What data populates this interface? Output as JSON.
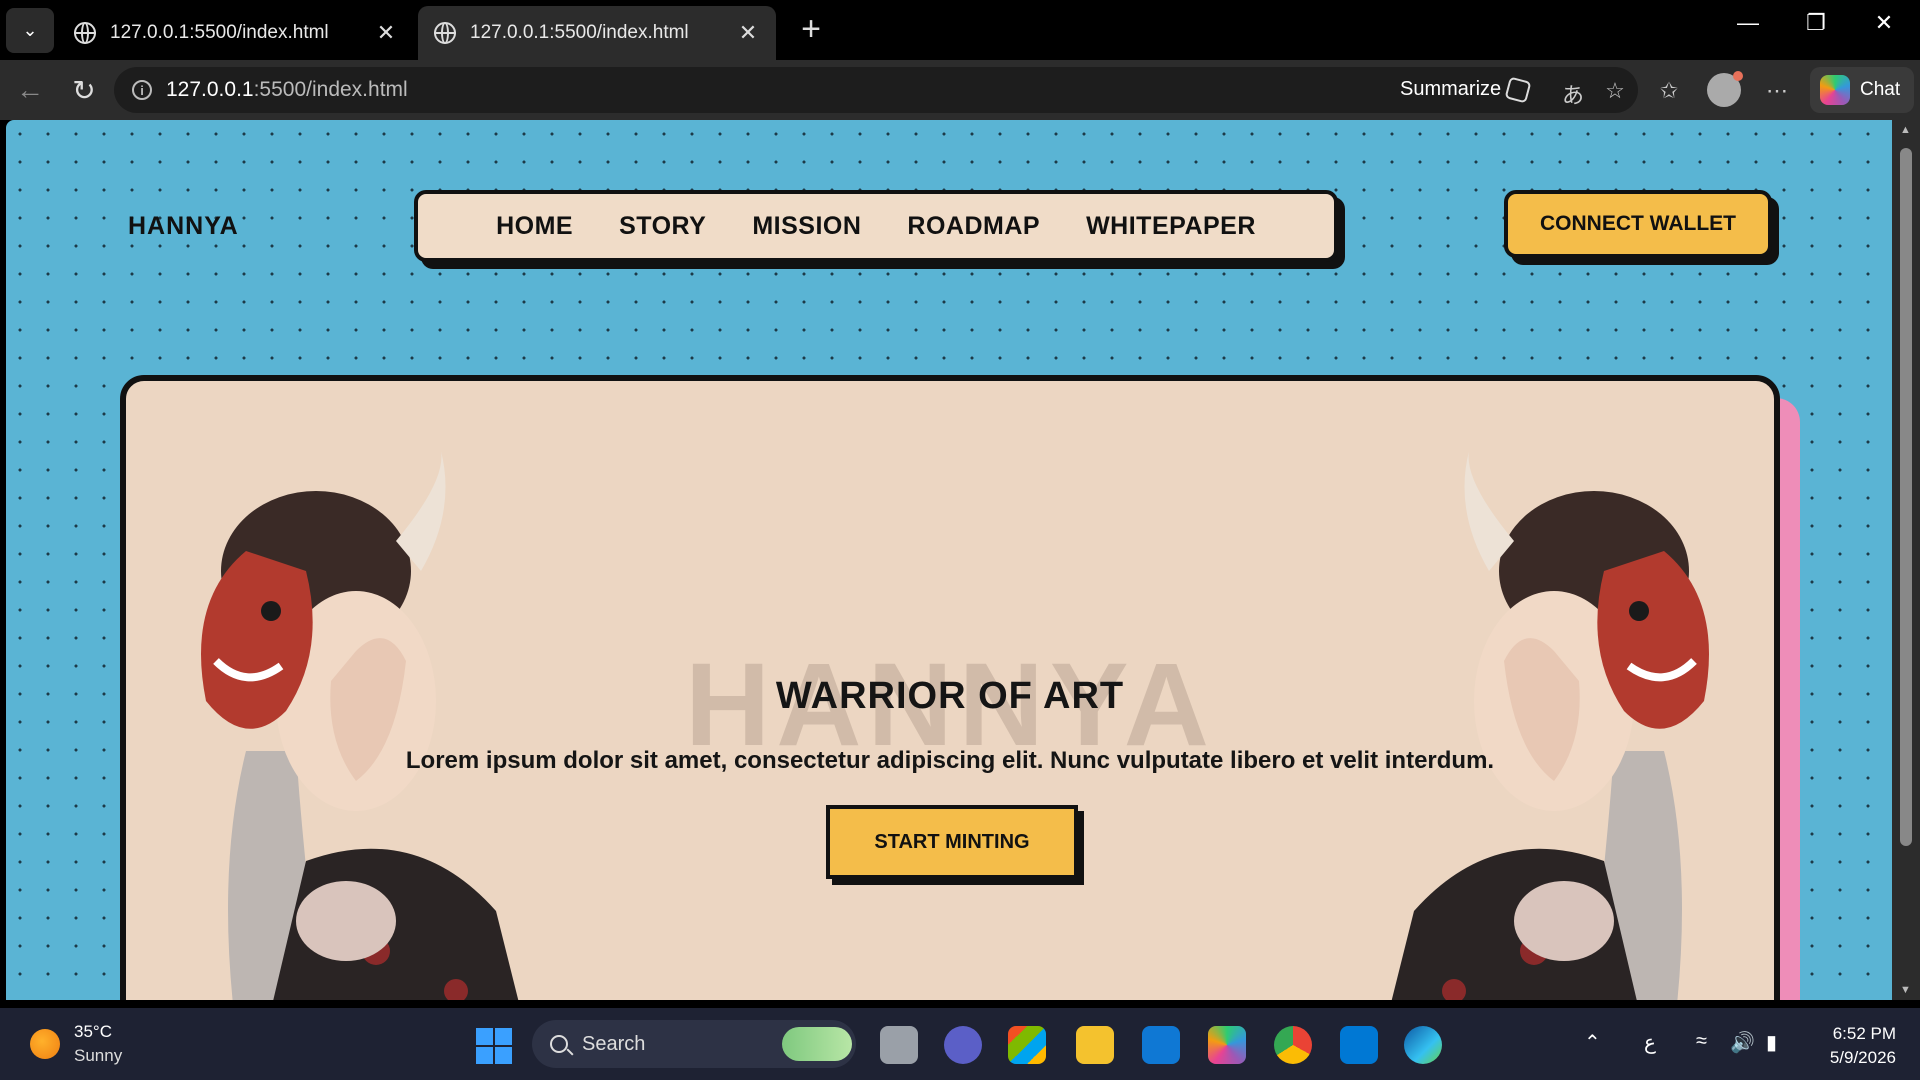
{
  "browser": {
    "tabs": [
      {
        "title": "127.0.0.1:5500/index.html",
        "active": false
      },
      {
        "title": "127.0.0.1:5500/index.html",
        "active": true
      }
    ],
    "address": {
      "host": "127.0.0.1",
      "path": ":5500/index.html"
    },
    "summarize_label": "Summarize",
    "chat_label": "Chat"
  },
  "page": {
    "brand": "HANNYA",
    "nav": [
      "HOME",
      "STORY",
      "MISSION",
      "ROADMAP",
      "WHITEPAPER"
    ],
    "connect_wallet": "CONNECT WALLET",
    "hero": {
      "background_word": "HANNYA",
      "title": "WARRIOR OF ART",
      "description": "Lorem ipsum dolor sit amet, consectetur adipiscing elit. Nunc vulputate libero et velit interdum.",
      "cta": "START MINTING"
    },
    "colors": {
      "background": "#5ab4d4",
      "card": "#ecd6c2",
      "accent": "#f4bd4a",
      "card_shadow": "#ee8db8"
    }
  },
  "taskbar": {
    "weather": {
      "temp": "35°C",
      "condition": "Sunny"
    },
    "search_label": "Search",
    "time": "6:52 PM",
    "date": "5/9/2026",
    "language": "ع"
  }
}
